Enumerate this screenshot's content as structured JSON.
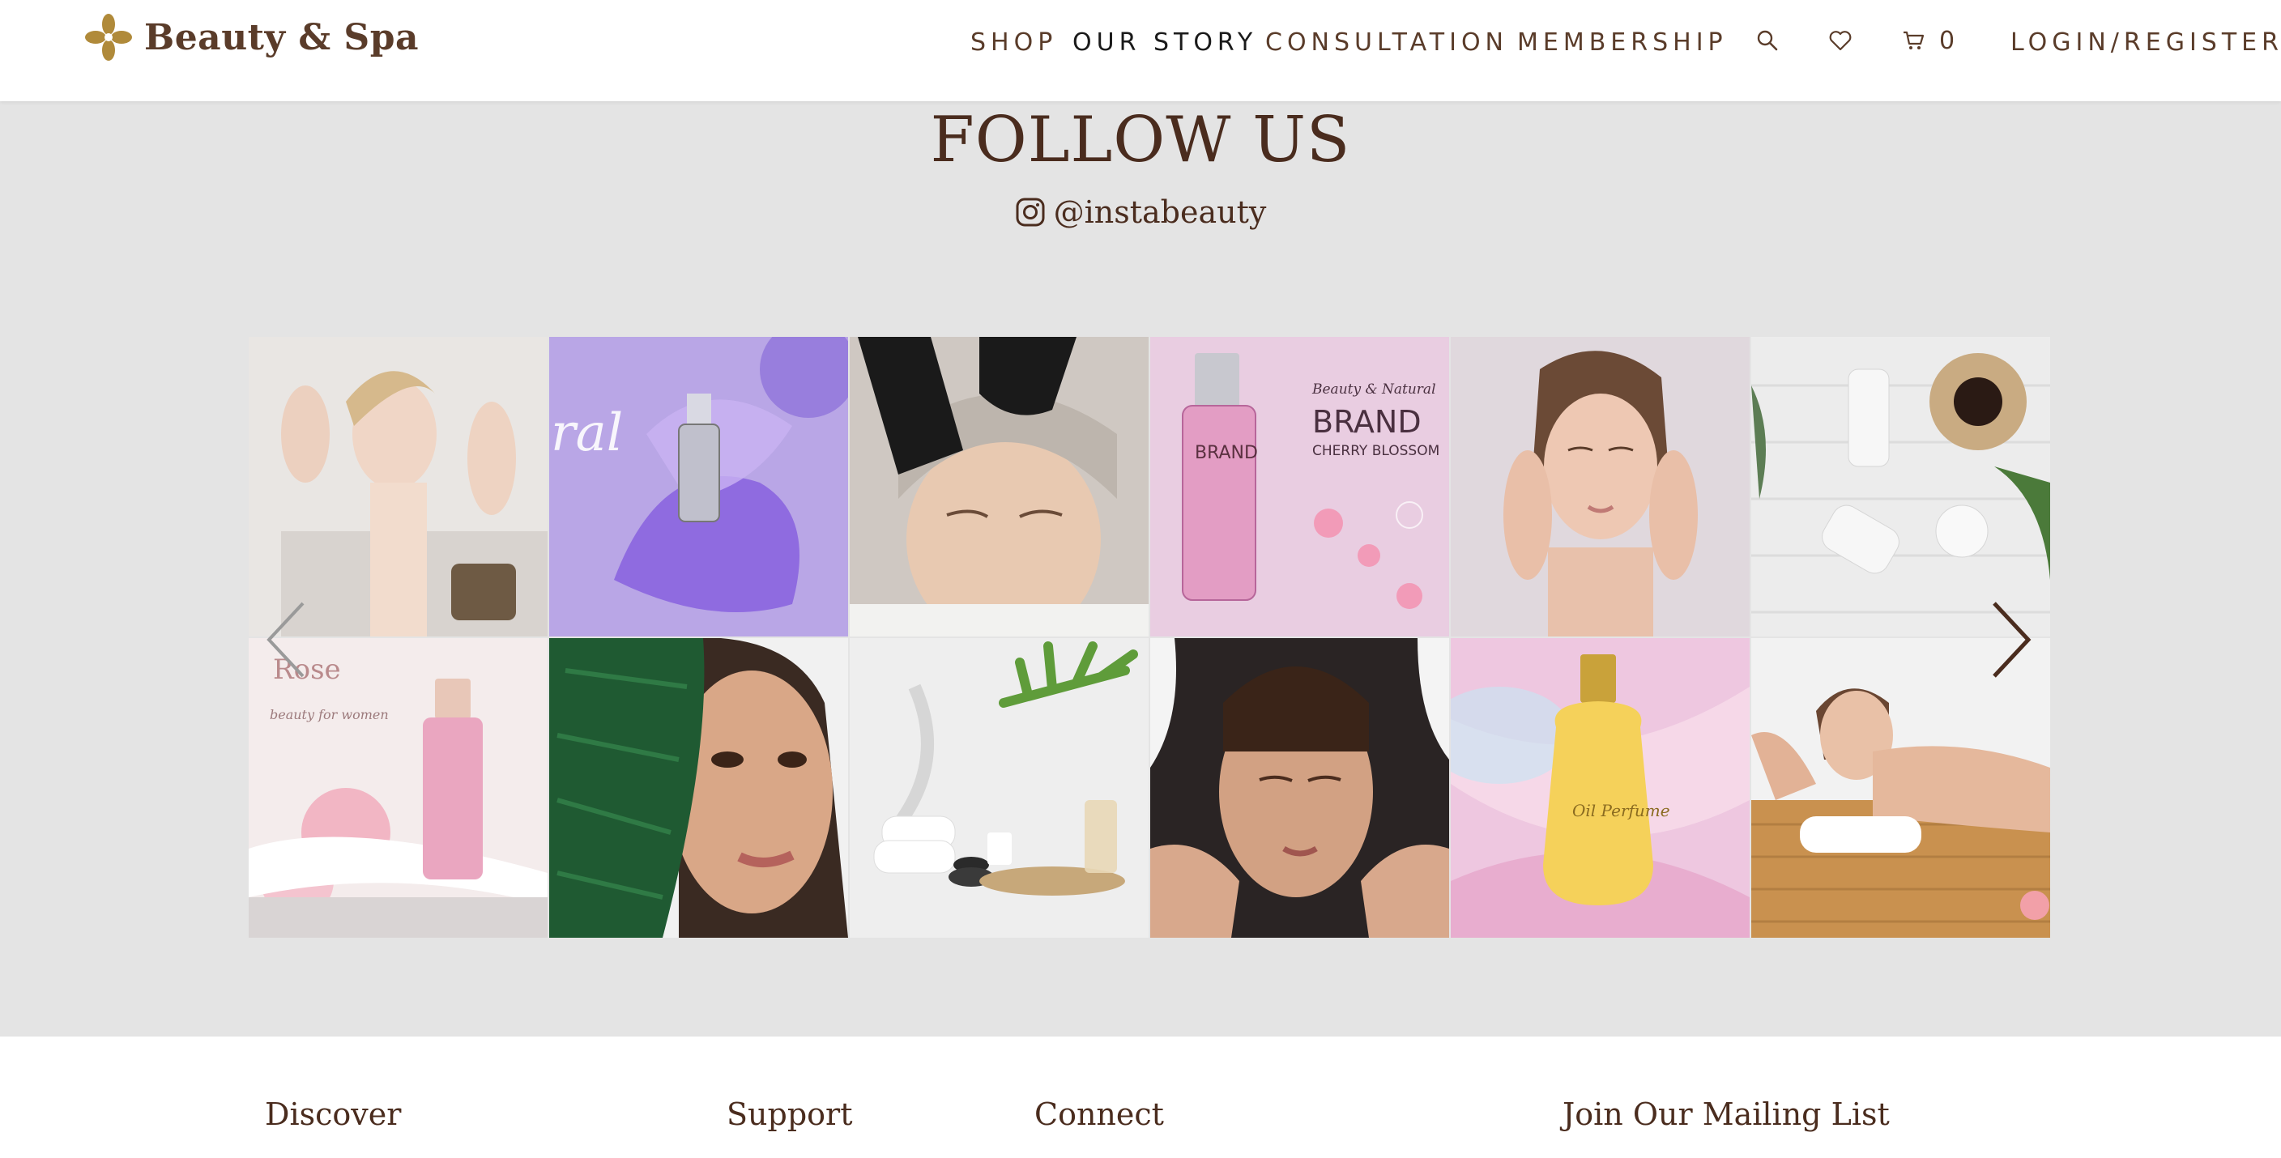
{
  "brand": {
    "name": "Beauty & Spa"
  },
  "nav": {
    "items": [
      {
        "label": "SHOP"
      },
      {
        "label": "OUR STORY"
      },
      {
        "label": "CONSULTATION"
      },
      {
        "label": "MEMBERSHIP"
      }
    ],
    "cart_count": "0",
    "login_label": "LOGIN/REGISTER",
    "icons": [
      "search-icon",
      "heart-icon",
      "cart-icon"
    ]
  },
  "follow": {
    "title": "FOLLOW US",
    "handle": "@instabeauty",
    "icon": "instagram-icon"
  },
  "gallery": {
    "tiles": [
      {
        "text": ""
      },
      {
        "text": "ral"
      },
      {
        "text": ""
      },
      {
        "text_top": "Beauty & Natural",
        "brand": "BRAND",
        "sub": "CHERRY BLOSSOM",
        "bottle": "BRAND"
      },
      {
        "text": ""
      },
      {
        "text": ""
      },
      {
        "title": "Rose",
        "script": "beauty for women"
      },
      {
        "text": ""
      },
      {
        "text": ""
      },
      {
        "text": ""
      },
      {
        "label": "Oil Perfume"
      },
      {
        "text": ""
      }
    ]
  },
  "footer": {
    "headings": [
      "Discover",
      "Support",
      "Connect",
      "Join Our Mailing List"
    ]
  },
  "colors": {
    "brand_brown": "#5a3c2a",
    "gold": "#b08a3a",
    "page_bg": "#e4e4e4"
  }
}
